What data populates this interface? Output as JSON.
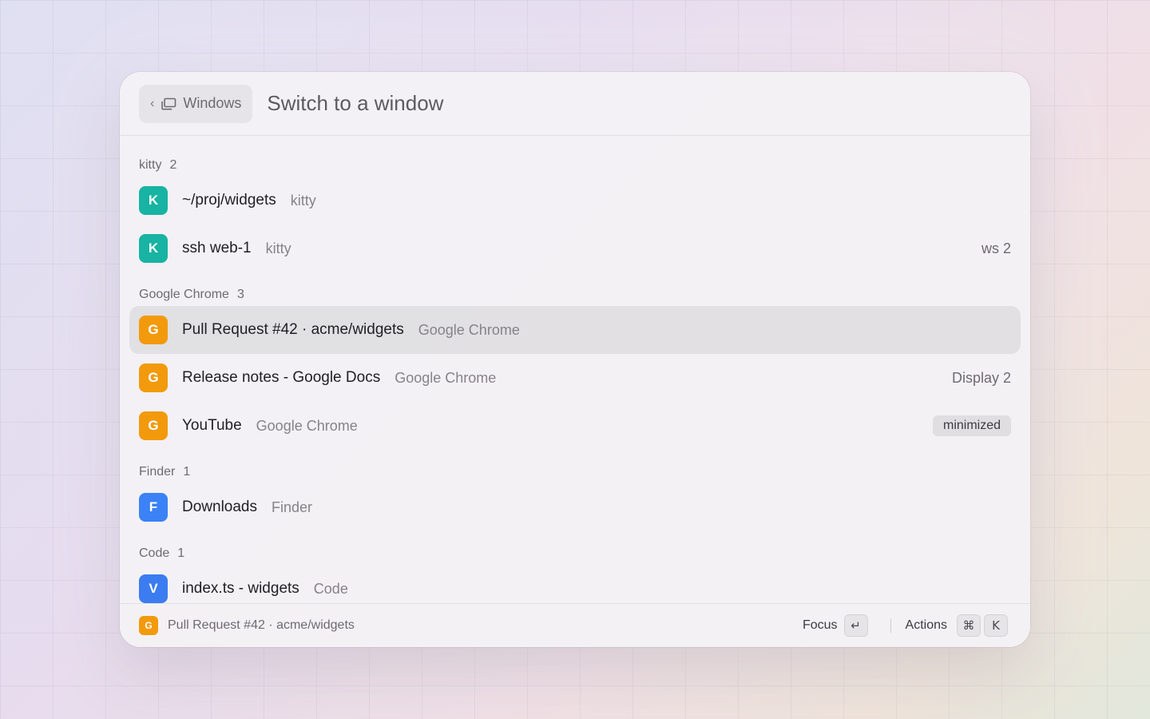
{
  "header": {
    "back_label": "Windows",
    "back_chevron": "‹",
    "search_placeholder": "Switch to a window"
  },
  "colors": {
    "kitty": "#17b3a3",
    "chrome": "#f29a0c",
    "finder": "#3b82f6",
    "code": "#3b7cf0"
  },
  "groups": [
    {
      "name": "kitty",
      "count": "2",
      "items": [
        {
          "icon_letter": "K",
          "title": "~/proj/widgets",
          "app": "kitty",
          "meta": ""
        },
        {
          "icon_letter": "K",
          "title": "ssh web-1",
          "app": "kitty",
          "meta": "ws 2"
        }
      ]
    },
    {
      "name": "Google Chrome",
      "count": "3",
      "items": [
        {
          "icon_letter": "G",
          "title": "Pull Request #42 · acme/widgets",
          "app": "Google Chrome",
          "meta": "",
          "selected": true
        },
        {
          "icon_letter": "G",
          "title": "Release notes - Google Docs",
          "app": "Google Chrome",
          "meta": "Display 2"
        },
        {
          "icon_letter": "G",
          "title": "YouTube",
          "app": "Google Chrome",
          "badge": "minimized"
        }
      ]
    },
    {
      "name": "Finder",
      "count": "1",
      "items": [
        {
          "icon_letter": "F",
          "title": "Downloads",
          "app": "Finder",
          "meta": ""
        }
      ]
    },
    {
      "name": "Code",
      "count": "1",
      "items": [
        {
          "icon_letter": "V",
          "title": "index.ts - widgets",
          "app": "Code",
          "meta": ""
        }
      ]
    }
  ],
  "footer": {
    "selected_icon_letter": "G",
    "selected_title": "Pull Request #42 · acme/widgets",
    "focus_label": "Focus",
    "focus_key": "↵",
    "actions_label": "Actions",
    "actions_key_1": "⌘",
    "actions_key_2": "K"
  }
}
